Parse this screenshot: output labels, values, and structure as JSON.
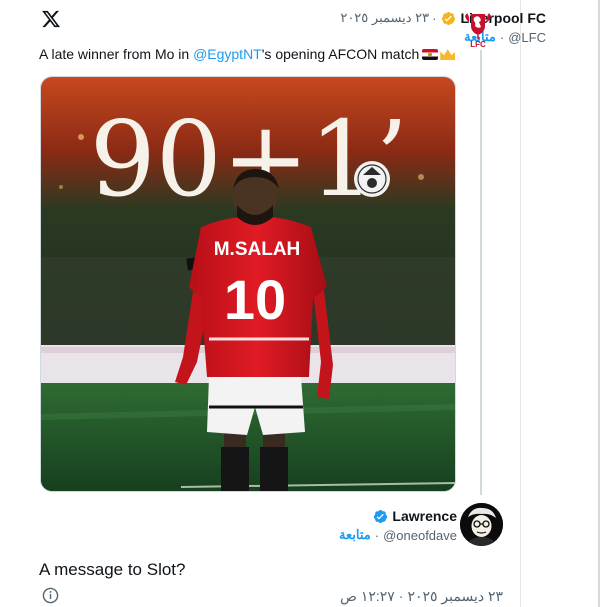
{
  "tweet": {
    "platform_logo": "x-logo-icon",
    "author_name": "Liverpool FC",
    "verified_icon": "verified-badge-icon",
    "date": "٢٣ ديسمبر ٢٠٢٥",
    "separator": "·",
    "follow_label": "متابعة",
    "handle": "@LFC",
    "avatar_icon": "liverpool-crest-icon",
    "text_before": "A late winner from Mo in ",
    "mention": "@EgyptNT",
    "text_after": "'s opening AFCON match",
    "emoji": [
      "egypt-flag-icon",
      "crown-icon"
    ],
    "media": {
      "headline": "90+1’",
      "shirt_name": "M.SALAH",
      "shirt_number": "10",
      "badge": "egyptian-football-association-badge"
    }
  },
  "reply": {
    "author_name": "Lawrence",
    "verified_icon": "verified-badge-icon",
    "follow_label": "متابعة",
    "separator": "·",
    "handle": "@oneofdave",
    "avatar_icon": "user-avatar",
    "text": "A message to Slot?",
    "time": "١٢:٢٧ ص",
    "date": "٢٣ ديسمبر ٢٠٢٥",
    "info_icon": "info-icon"
  },
  "colors": {
    "accent": "#1d9bf0",
    "text": "#0f1419",
    "muted": "#536471",
    "liverpool_red": "#c8102e",
    "egypt_red": "#d8141f",
    "pitch_green": "#1f5a2b"
  }
}
